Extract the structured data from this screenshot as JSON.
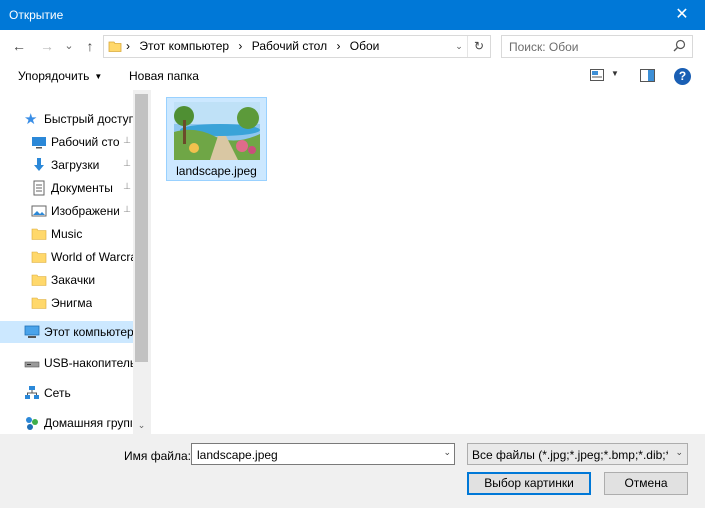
{
  "window": {
    "title": "Открытие",
    "close_glyph": "✕"
  },
  "nav": {
    "back_glyph": "←",
    "forward_glyph": "→",
    "recent_glyph": "⌄",
    "up_glyph": "↑",
    "breadcrumb": [
      "Этот компьютер",
      "Рабочий стол",
      "Обои"
    ],
    "separator": "›",
    "search_placeholder": "Поиск: Обои"
  },
  "toolbar": {
    "organize_label": "Упорядочить",
    "new_folder_label": "Новая папка",
    "help_glyph": "?"
  },
  "sidebar": {
    "items": [
      {
        "label": "Быстрый доступ",
        "icon": "star-icon",
        "pinned": false
      },
      {
        "label": "Рабочий сто.",
        "icon": "desktop-icon",
        "pinned": true
      },
      {
        "label": "Загрузки",
        "icon": "download-icon",
        "pinned": true
      },
      {
        "label": "Документы",
        "icon": "document-icon",
        "pinned": true
      },
      {
        "label": "Изображени",
        "icon": "pictures-icon",
        "pinned": true
      },
      {
        "label": "Music",
        "icon": "folder-icon",
        "pinned": false
      },
      {
        "label": "World of Warcra",
        "icon": "folder-icon",
        "pinned": false
      },
      {
        "label": "Закачки",
        "icon": "folder-icon",
        "pinned": false
      },
      {
        "label": "Энигма",
        "icon": "folder-icon",
        "pinned": false
      },
      {
        "label": "Этот компьютер",
        "icon": "computer-icon",
        "pinned": false
      },
      {
        "label": "USB-накопитель",
        "icon": "usb-drive-icon",
        "pinned": false
      },
      {
        "label": "Сеть",
        "icon": "network-icon",
        "pinned": false
      },
      {
        "label": "Домашняя групп",
        "icon": "homegroup-icon",
        "pinned": false
      }
    ],
    "selected_label": "Этот компьютер",
    "pin_glyph": "📌",
    "scroll_down_glyph": "⌄"
  },
  "files": [
    {
      "name": "landscape.jpeg",
      "selected": true
    }
  ],
  "footer": {
    "filename_label": "Имя файла:",
    "filename_value": "landscape.jpeg",
    "filetype_value": "Все файлы (*.jpg;*.jpeg;*.bmp;*.dib;*.p",
    "open_button": "Выбор картинки",
    "cancel_button": "Отмена",
    "dropdown_glyph": "⌄"
  },
  "colors": {
    "accent": "#0078d7",
    "selection": "#cce8ff",
    "folder": "#ffd86b"
  }
}
